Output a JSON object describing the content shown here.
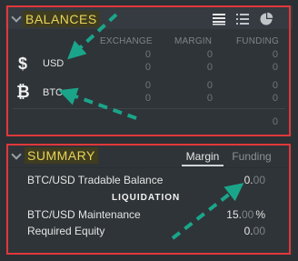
{
  "balances": {
    "title": "BALANCES",
    "view_icons": [
      "list-detailed-icon",
      "list-icon",
      "pie-chart-icon"
    ],
    "columns": [
      "EXCHANGE",
      "MARGIN",
      "FUNDING"
    ],
    "rows": [
      {
        "symbol": "$",
        "currency": "USD",
        "values": [
          [
            "0",
            "0"
          ],
          [
            "0",
            "0"
          ],
          [
            "0",
            "0"
          ]
        ]
      },
      {
        "symbol": "₿",
        "currency": "BTC",
        "values": [
          [
            "0",
            "0"
          ],
          [
            "0",
            "0"
          ],
          [
            "0",
            "0"
          ]
        ]
      }
    ],
    "total": "0"
  },
  "summary": {
    "title": "SUMMARY",
    "tabs": [
      "Margin",
      "Funding"
    ],
    "active_tab": "Margin",
    "tradable_label": "BTC/USD Tradable Balance",
    "tradable_int": "0.",
    "tradable_dec": "00",
    "liquidation_label": "LIQUIDATION",
    "maintenance_label": "BTC/USD Maintenance",
    "maintenance_int": "15.",
    "maintenance_dec": "00",
    "maintenance_unit": "%",
    "equity_label": "Required Equity",
    "equity_int": "0.",
    "equity_dec": "00"
  },
  "colors": {
    "highlight_frame": "#e0383b",
    "title_text": "#e8d55a",
    "arrow": "#1aa58a"
  }
}
